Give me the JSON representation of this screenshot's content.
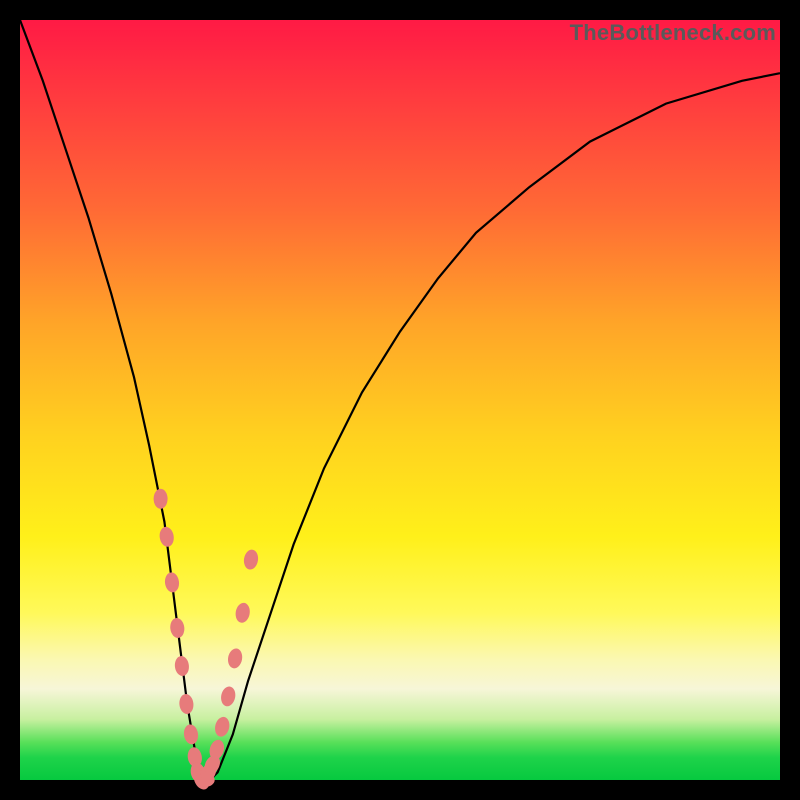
{
  "watermark": "TheBottleneck.com",
  "colors": {
    "gradient_top": "#ff1a45",
    "gradient_mid": "#ffd21f",
    "gradient_bottom": "#06c93f",
    "curve": "#000000",
    "marker": "#e77b7b",
    "frame": "#000000"
  },
  "chart_data": {
    "type": "line",
    "title": "",
    "xlabel": "",
    "ylabel": "",
    "xlim": [
      0,
      100
    ],
    "ylim": [
      0,
      100
    ],
    "grid": false,
    "legend": false,
    "series": [
      {
        "name": "bottleneck-curve",
        "x": [
          0,
          3,
          6,
          9,
          12,
          15,
          17,
          19,
          20,
          21,
          22,
          23,
          24,
          25,
          26,
          28,
          30,
          33,
          36,
          40,
          45,
          50,
          55,
          60,
          67,
          75,
          85,
          95,
          100
        ],
        "y": [
          100,
          92,
          83,
          74,
          64,
          53,
          44,
          34,
          26,
          18,
          10,
          4,
          1,
          0,
          1,
          6,
          13,
          22,
          31,
          41,
          51,
          59,
          66,
          72,
          78,
          84,
          89,
          92,
          93
        ]
      }
    ],
    "markers": {
      "name": "highlight-points",
      "x": [
        18.5,
        19.3,
        20.0,
        20.7,
        21.3,
        21.9,
        22.5,
        23.0,
        23.4,
        23.9,
        24.3,
        24.8,
        25.3,
        25.9,
        26.6,
        27.4,
        28.3,
        29.3,
        30.4
      ],
      "y": [
        37,
        32,
        26,
        20,
        15,
        10,
        6,
        3,
        1,
        0,
        0,
        1,
        2,
        4,
        7,
        11,
        16,
        22,
        29
      ]
    }
  }
}
